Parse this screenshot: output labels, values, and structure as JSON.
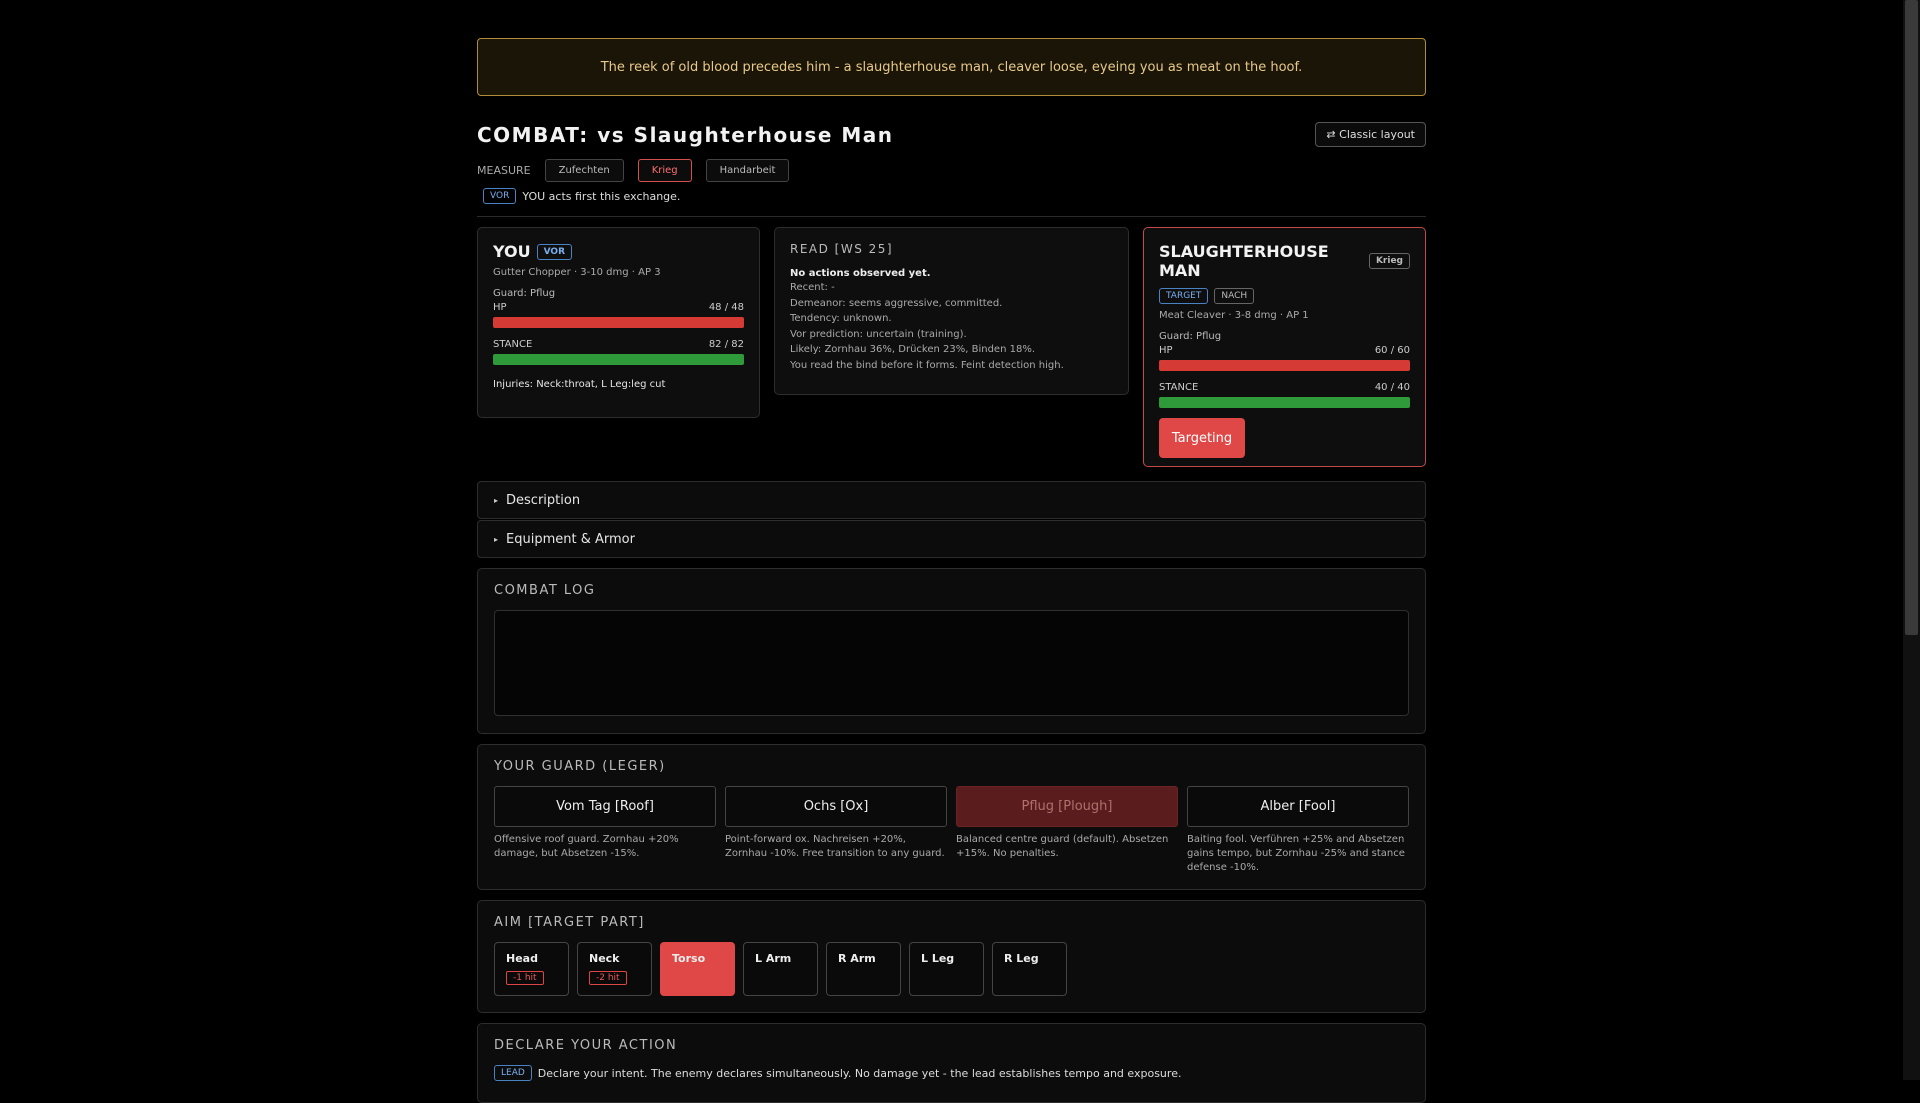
{
  "banner": "The reek of old blood precedes him - a slaughterhouse man, cleaver loose, eyeing you as meat on the hoof.",
  "title": "COMBAT: vs Slaughterhouse Man",
  "classic_layout": "⇄ Classic layout",
  "measure": {
    "label": "MEASURE",
    "options": [
      "Zufechten",
      "Krieg",
      "Handarbeit"
    ],
    "selected": "Krieg"
  },
  "vor": {
    "tag": "VOR",
    "text": "YOU acts first this exchange."
  },
  "you": {
    "name": "YOU",
    "tag": "VOR",
    "weapon": "Gutter Chopper · 3-10 dmg · AP 3",
    "guard": "Guard: Pflug",
    "hp_label": "HP",
    "hp": "48 / 48",
    "hp_fraction": 1.0,
    "stance_label": "STANCE",
    "stance": "82 / 82",
    "stance_fraction": 1.0,
    "injuries": "Injuries: Neck:throat, L Leg:leg cut"
  },
  "read": {
    "title": "READ [WS 25]",
    "headline": "No actions observed yet.",
    "lines": [
      "Recent: -",
      "Demeanor: seems aggressive, committed.",
      "Tendency: unknown.",
      "Vor prediction: uncertain (training).",
      "Likely: Zornhau 36%, Drücken 23%, Binden 18%.",
      "You read the bind before it forms. Feint detection high."
    ]
  },
  "enemy": {
    "name": "SLAUGHTERHOUSE MAN",
    "measure_tag": "Krieg",
    "tags": [
      "TARGET",
      "NACH"
    ],
    "weapon": "Meat Cleaver · 3-8 dmg · AP 1",
    "guard": "Guard: Pflug",
    "hp_label": "HP",
    "hp": "60 / 60",
    "hp_fraction": 1.0,
    "stance_label": "STANCE",
    "stance": "40 / 40",
    "stance_fraction": 1.0,
    "targeting": "Targeting"
  },
  "sections": {
    "description": "Description",
    "equipment": "Equipment & Armor"
  },
  "combat_log": {
    "title": "COMBAT LOG"
  },
  "guard_panel": {
    "title": "YOUR GUARD (LEGER)",
    "guards": [
      {
        "name": "Vom Tag [Roof]",
        "desc": "Offensive roof guard. Zornhau +20% damage, but Absetzen -15%."
      },
      {
        "name": "Ochs [Ox]",
        "desc": "Point-forward ox. Nachreisen +20%, Zornhau -10%. Free transition to any guard."
      },
      {
        "name": "Pflug [Plough]",
        "desc": "Balanced centre guard (default). Absetzen +15%. No penalties."
      },
      {
        "name": "Alber [Fool]",
        "desc": "Baiting fool. Verführen +25% and Absetzen gains tempo, but Zornhau -25% and stance defense -10%."
      }
    ],
    "selected": "Pflug [Plough]"
  },
  "aim_panel": {
    "title": "AIM [TARGET PART]",
    "parts": [
      {
        "name": "Head",
        "penalty": "-1 hit"
      },
      {
        "name": "Neck",
        "penalty": "-2 hit"
      },
      {
        "name": "Torso",
        "penalty": ""
      },
      {
        "name": "L Arm",
        "penalty": ""
      },
      {
        "name": "R Arm",
        "penalty": ""
      },
      {
        "name": "L Leg",
        "penalty": ""
      },
      {
        "name": "R Leg",
        "penalty": ""
      }
    ],
    "selected": "Torso"
  },
  "declare": {
    "title": "DECLARE YOUR ACTION",
    "tag": "LEAD",
    "text": "Declare your intent. The enemy declares simultaneously. No damage yet - the lead establishes tempo and exposure."
  }
}
